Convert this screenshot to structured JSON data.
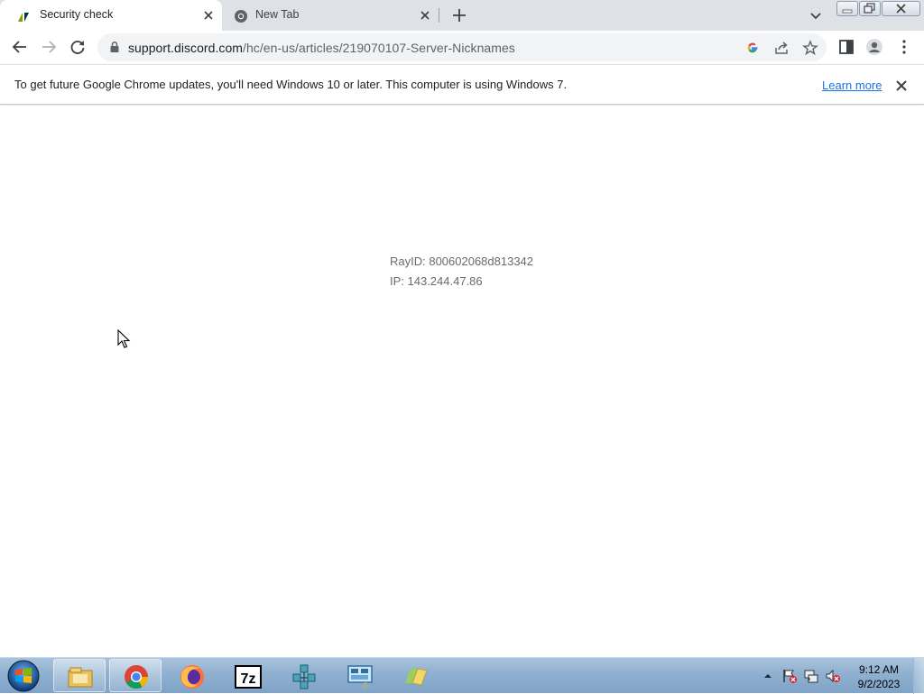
{
  "browser": {
    "tabs": [
      {
        "title": "Security check",
        "active": true,
        "favicon": "zendesk-icon"
      },
      {
        "title": "New Tab",
        "active": false,
        "favicon": "chrome-icon"
      }
    ],
    "address": {
      "host": "support.discord.com",
      "path": "/hc/en-us/articles/219070107-Server-Nicknames"
    },
    "infobar": {
      "message": "To get future Google Chrome updates, you'll need Windows 10 or later. This computer is using Windows 7.",
      "link": "Learn more"
    }
  },
  "page": {
    "rayid": "RayID: 800602068d813342",
    "ip": "IP: 143.244.47.86"
  },
  "taskbar": {
    "apps": [
      "file-explorer-icon",
      "chrome-icon",
      "firefox-icon",
      "7zip-icon",
      "network-tool-icon",
      "remote-desktop-icon",
      "folder-icon"
    ],
    "clock": {
      "time": "9:12 AM",
      "date": "9/2/2023"
    }
  },
  "colors": {
    "tabstrip": "#dee1e6",
    "omnibox": "#f1f3f4",
    "link": "#1a73e8",
    "taskbar": "#8fb0d0"
  }
}
